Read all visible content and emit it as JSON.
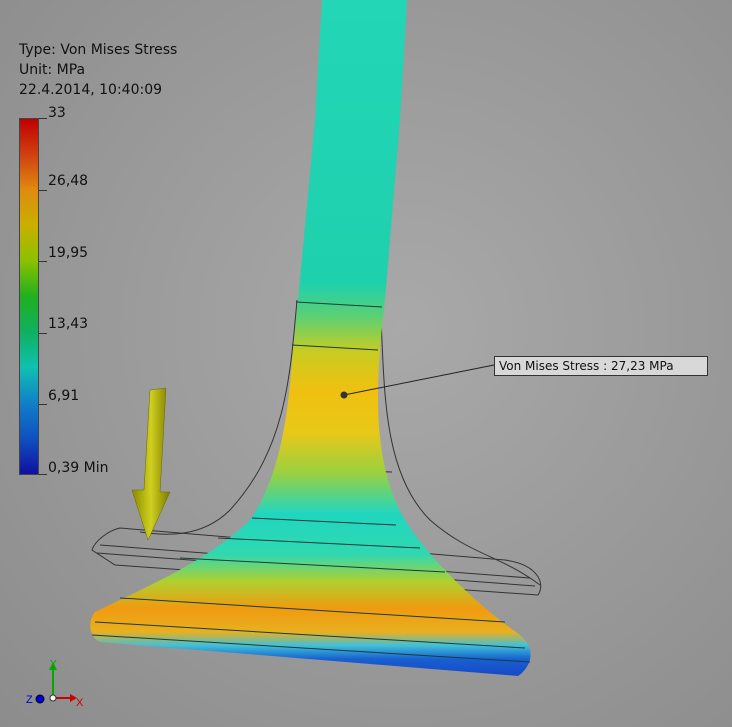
{
  "info": {
    "type_line": "Type: Von Mises Stress",
    "unit_line": "Unit: MPa",
    "date_line": "22.4.2014, 10:40:09"
  },
  "legend": {
    "labels": [
      "33",
      "26,48",
      "19,95",
      "13,43",
      "6,91",
      "0,39 Min"
    ],
    "colors": [
      "#c00000",
      "#e08a10",
      "#c8b000",
      "#20b020",
      "#10c0b0",
      "#1050c0",
      "#1010a0"
    ]
  },
  "probe": {
    "label": "Von Mises Stress : 27,23 MPa"
  },
  "axes": {
    "x": "X",
    "y": "Y",
    "z": "Z"
  },
  "load": {
    "icon": "force-arrow-icon"
  }
}
